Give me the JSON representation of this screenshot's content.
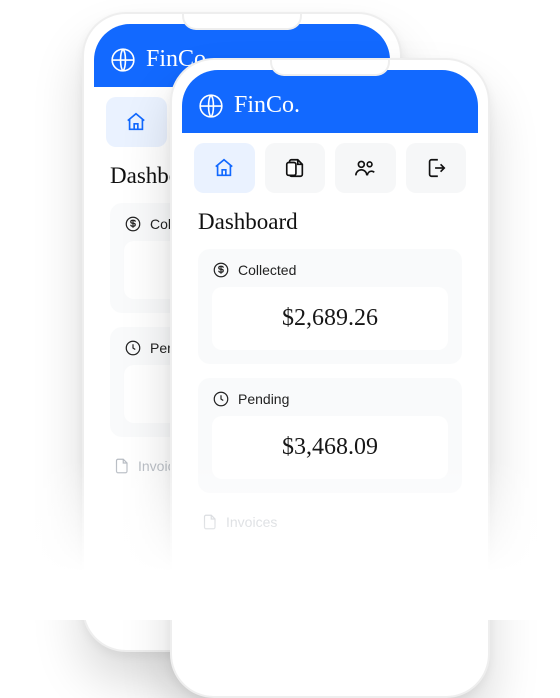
{
  "header": {
    "brand": "FinCo."
  },
  "nav": {
    "items": [
      {
        "name": "home",
        "active": true
      },
      {
        "name": "files",
        "active": false
      },
      {
        "name": "people",
        "active": false
      },
      {
        "name": "logout",
        "active": false
      }
    ]
  },
  "page": {
    "title": "Dashboard"
  },
  "cards": {
    "collected": {
      "label": "Collected",
      "amount": "$2,689.26"
    },
    "pending": {
      "label": "Pending",
      "amount": "$3,468.09"
    }
  },
  "sections": {
    "invoices": {
      "label": "Invoices"
    }
  },
  "colors": {
    "accent": "#1269ff"
  }
}
